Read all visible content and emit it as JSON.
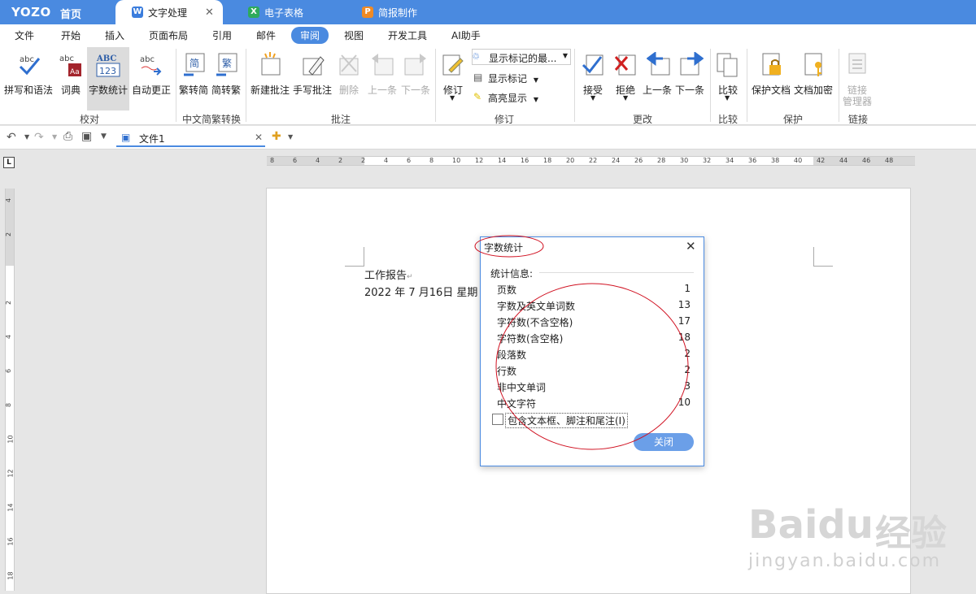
{
  "titlebar": {
    "logo": "YOZO",
    "home": "首页",
    "tabs": [
      {
        "label": "文字处理",
        "icon": "W"
      },
      {
        "label": "电子表格",
        "icon": "X"
      },
      {
        "label": "简报制作",
        "icon": "P"
      }
    ]
  },
  "menu": [
    "文件",
    "开始",
    "插入",
    "页面布局",
    "引用",
    "邮件",
    "审阅",
    "视图",
    "开发工具",
    "AI助手"
  ],
  "ribbon": {
    "proofing": {
      "spell": "拼写和语法",
      "dict": "词典",
      "count": "字数统计",
      "autocorrect": "自动更正",
      "group": "校对"
    },
    "chinese": {
      "t2s": "繁转简",
      "s2t": "简转繁",
      "group": "中文简繁转换"
    },
    "comments": {
      "new": "新建批注",
      "ink": "手写批注",
      "delete": "删除",
      "prev": "上一条",
      "next": "下一条",
      "group": "批注"
    },
    "tracking": {
      "track": "修订",
      "show_markup": "显示标记的最...",
      "show_marks": "显示标记",
      "highlight": "高亮显示",
      "group": "修订"
    },
    "changes": {
      "accept": "接受",
      "reject": "拒绝",
      "prev": "上一条",
      "next": "下一条",
      "group": "更改"
    },
    "compare": {
      "compare": "比较",
      "group": "比较"
    },
    "protect": {
      "protect_doc": "保护文档",
      "encrypt": "文档加密",
      "group": "保护"
    },
    "links": {
      "manager1": "链接",
      "manager2": "管理器",
      "group": "链接"
    }
  },
  "qat": {
    "doc_tab": "文件1"
  },
  "ruler": {
    "h_ticks": [
      "8",
      "6",
      "4",
      "2",
      "2",
      "4",
      "6",
      "8",
      "10",
      "12",
      "14",
      "16",
      "18",
      "20",
      "22",
      "24",
      "26",
      "28",
      "30",
      "32",
      "34",
      "36",
      "38",
      "40",
      "42",
      "44",
      "46",
      "48"
    ],
    "v_ticks": [
      "4",
      "2",
      "2",
      "4",
      "6",
      "8",
      "10",
      "12",
      "14",
      "16",
      "18"
    ]
  },
  "document": {
    "line1": "工作报告",
    "line2": "2022 年 7 月16日 星期"
  },
  "dialog": {
    "title": "字数统计",
    "section": "统计信息:",
    "rows": [
      {
        "label": "页数",
        "value": "1"
      },
      {
        "label": "字数及英文单词数",
        "value": "13"
      },
      {
        "label": "字符数(不含空格)",
        "value": "17"
      },
      {
        "label": "字符数(含空格)",
        "value": "18"
      },
      {
        "label": "段落数",
        "value": "2"
      },
      {
        "label": "行数",
        "value": "2"
      },
      {
        "label": "非中文单词",
        "value": "3"
      },
      {
        "label": "中文字符",
        "value": "10"
      }
    ],
    "checkbox_label": "包含文本框、脚注和尾注(I)",
    "close_button": "关闭"
  },
  "watermark": {
    "brand": "Baidu",
    "cn": "经验",
    "url": "jingyan.baidu.com"
  },
  "colors": {
    "accent": "#4a8ae0",
    "annotation": "#d01020"
  }
}
